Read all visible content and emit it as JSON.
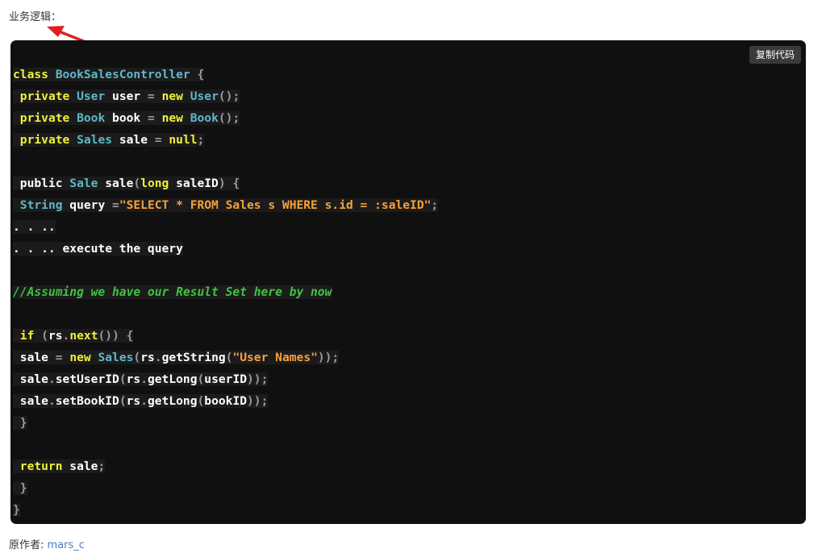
{
  "intro_label": "业务逻辑：",
  "copy_button": "复制代码",
  "code_lines": [
    [
      [
        "kw",
        "class"
      ],
      [
        "t",
        " "
      ],
      [
        "type",
        "BookSalesController"
      ],
      [
        "t",
        " "
      ],
      [
        "pun",
        "{"
      ]
    ],
    [
      [
        "t",
        " "
      ],
      [
        "kw",
        "private"
      ],
      [
        "t",
        " "
      ],
      [
        "type",
        "User"
      ],
      [
        "t",
        " user "
      ],
      [
        "pun",
        "="
      ],
      [
        "t",
        " "
      ],
      [
        "kw",
        "new"
      ],
      [
        "t",
        " "
      ],
      [
        "type",
        "User"
      ],
      [
        "pun",
        "();"
      ]
    ],
    [
      [
        "t",
        " "
      ],
      [
        "kw",
        "private"
      ],
      [
        "t",
        " "
      ],
      [
        "type",
        "Book"
      ],
      [
        "t",
        " book "
      ],
      [
        "pun",
        "="
      ],
      [
        "t",
        " "
      ],
      [
        "kw",
        "new"
      ],
      [
        "t",
        " "
      ],
      [
        "type",
        "Book"
      ],
      [
        "pun",
        "();"
      ]
    ],
    [
      [
        "t",
        " "
      ],
      [
        "kw",
        "private"
      ],
      [
        "t",
        " "
      ],
      [
        "type",
        "Sales"
      ],
      [
        "t",
        " sale "
      ],
      [
        "pun",
        "="
      ],
      [
        "t",
        " "
      ],
      [
        "kw",
        "null"
      ],
      [
        "pun",
        ";"
      ]
    ],
    [],
    [
      [
        "t",
        " public "
      ],
      [
        "type",
        "Sale"
      ],
      [
        "t",
        " sale"
      ],
      [
        "pun",
        "("
      ],
      [
        "kw",
        "long"
      ],
      [
        "t",
        " saleID"
      ],
      [
        "pun",
        ")"
      ],
      [
        "t",
        " "
      ],
      [
        "pun",
        "{"
      ]
    ],
    [
      [
        "t",
        " "
      ],
      [
        "type",
        "String"
      ],
      [
        "t",
        " query "
      ],
      [
        "pun",
        "="
      ],
      [
        "str",
        "\"SELECT * FROM Sales s WHERE s.id = :saleID\""
      ],
      [
        "pun",
        ";"
      ]
    ],
    [
      [
        "t",
        ". . .."
      ]
    ],
    [
      [
        "t",
        ". . .. execute the query"
      ]
    ],
    [],
    [
      [
        "cmt",
        "//Assuming we have our Result Set here by now"
      ]
    ],
    [],
    [
      [
        "t",
        " "
      ],
      [
        "kw",
        "if"
      ],
      [
        "t",
        " "
      ],
      [
        "pun",
        "("
      ],
      [
        "t",
        "rs"
      ],
      [
        "pun",
        "."
      ],
      [
        "kw",
        "next"
      ],
      [
        "pun",
        "())"
      ],
      [
        "t",
        " "
      ],
      [
        "pun",
        "{"
      ]
    ],
    [
      [
        "t",
        " sale "
      ],
      [
        "pun",
        "="
      ],
      [
        "t",
        " "
      ],
      [
        "kw",
        "new"
      ],
      [
        "t",
        " "
      ],
      [
        "type",
        "Sales"
      ],
      [
        "pun",
        "("
      ],
      [
        "t",
        "rs"
      ],
      [
        "pun",
        "."
      ],
      [
        "t",
        "getString"
      ],
      [
        "pun",
        "("
      ],
      [
        "str",
        "\"User Names\""
      ],
      [
        "pun",
        "));"
      ]
    ],
    [
      [
        "t",
        " sale"
      ],
      [
        "pun",
        "."
      ],
      [
        "t",
        "setUserID"
      ],
      [
        "pun",
        "("
      ],
      [
        "t",
        "rs"
      ],
      [
        "pun",
        "."
      ],
      [
        "t",
        "getLong"
      ],
      [
        "pun",
        "("
      ],
      [
        "t",
        "userID"
      ],
      [
        "pun",
        "));"
      ]
    ],
    [
      [
        "t",
        " sale"
      ],
      [
        "pun",
        "."
      ],
      [
        "t",
        "setBookID"
      ],
      [
        "pun",
        "("
      ],
      [
        "t",
        "rs"
      ],
      [
        "pun",
        "."
      ],
      [
        "t",
        "getLong"
      ],
      [
        "pun",
        "("
      ],
      [
        "t",
        "bookID"
      ],
      [
        "pun",
        "));"
      ]
    ],
    [
      [
        "t",
        " "
      ],
      [
        "pun",
        "}"
      ]
    ],
    [],
    [
      [
        "t",
        " "
      ],
      [
        "kw",
        "return"
      ],
      [
        "t",
        " sale"
      ],
      [
        "pun",
        ";"
      ]
    ],
    [
      [
        "t",
        " "
      ],
      [
        "pun",
        "}"
      ]
    ],
    [
      [
        "pun",
        "}"
      ]
    ]
  ],
  "footer": {
    "label": "原作者: ",
    "author": "mars_c"
  },
  "colors": {
    "background": "#101010",
    "keyword": "#f0f03c",
    "type": "#5fb8c8",
    "string": "#f8a03c",
    "comment": "#3fc33f",
    "punctuation": "#9a9a9a",
    "arrow": "#e02020"
  }
}
